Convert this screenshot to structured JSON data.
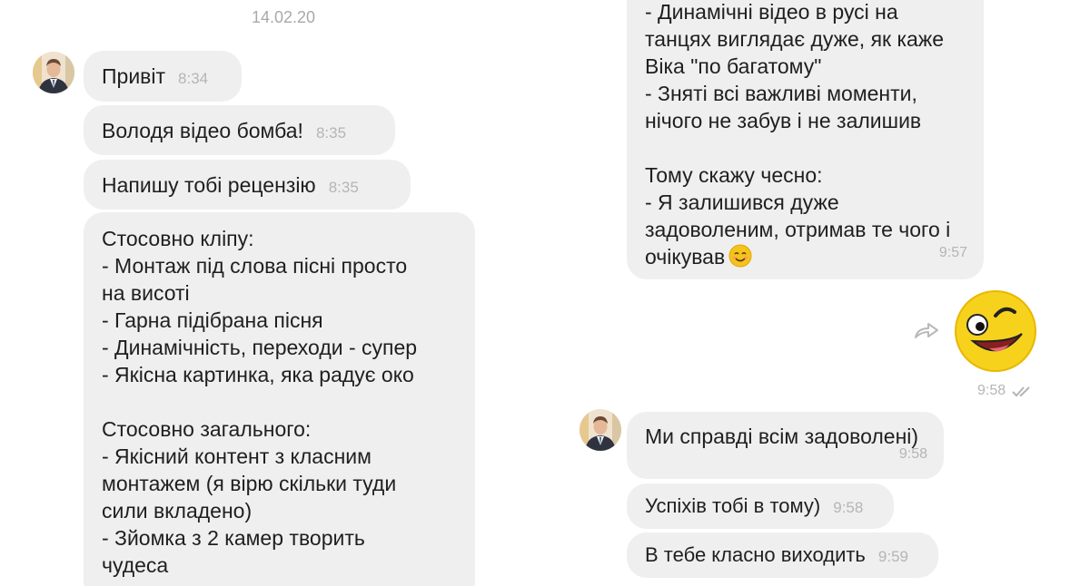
{
  "left": {
    "date": "14.02.20",
    "messages": [
      {
        "text": "Привіт",
        "time": "8:34"
      },
      {
        "text": "Володя відео бомба!",
        "time": "8:35"
      },
      {
        "text": "Напишу тобі рецензію",
        "time": "8:35"
      },
      {
        "text": "Стосовно кліпу:\n- Монтаж під слова пісні просто\nна висоті\n- Гарна підібрана пісня\n- Динамічність, переходи - супер\n- Якісна картинка, яка радує око\n\nСтосовно загального:\n- Якісний контент з класним\nмонтажем (я вірю скільки туди\nсили вкладено)\n- Зйомка з 2 камер творить\nчудеса"
      }
    ]
  },
  "right": {
    "long_message": {
      "text": "- Динамічні відео в русі на\nтанцях виглядає дуже, як каже\nВіка \"по багатому\"\n- Зняті всі важливі моменти,\nнічого не забув і не залишив\n\nТому скажу чесно:\n- Я залишився дуже\nзадоволеним, отримав те чого і\nочікував",
      "time": "9:57",
      "emoji": "smiling-face-emoji"
    },
    "sticker": {
      "icon": "winking-laughing-face-sticker",
      "time": "9:58",
      "status_icon": "double-check-icon",
      "forward_icon": "forward-arrow-icon"
    },
    "messages": [
      {
        "text": "Ми справді всім задоволені)",
        "time": "9:58"
      },
      {
        "text": "Успіхів тобі в тому)",
        "time": "9:58"
      },
      {
        "text": "В тебе класно виходить",
        "time": "9:59"
      }
    ]
  },
  "colors": {
    "bubble": "#efefef",
    "meta": "#b5b5b5",
    "sticker": "#f6d21d"
  }
}
